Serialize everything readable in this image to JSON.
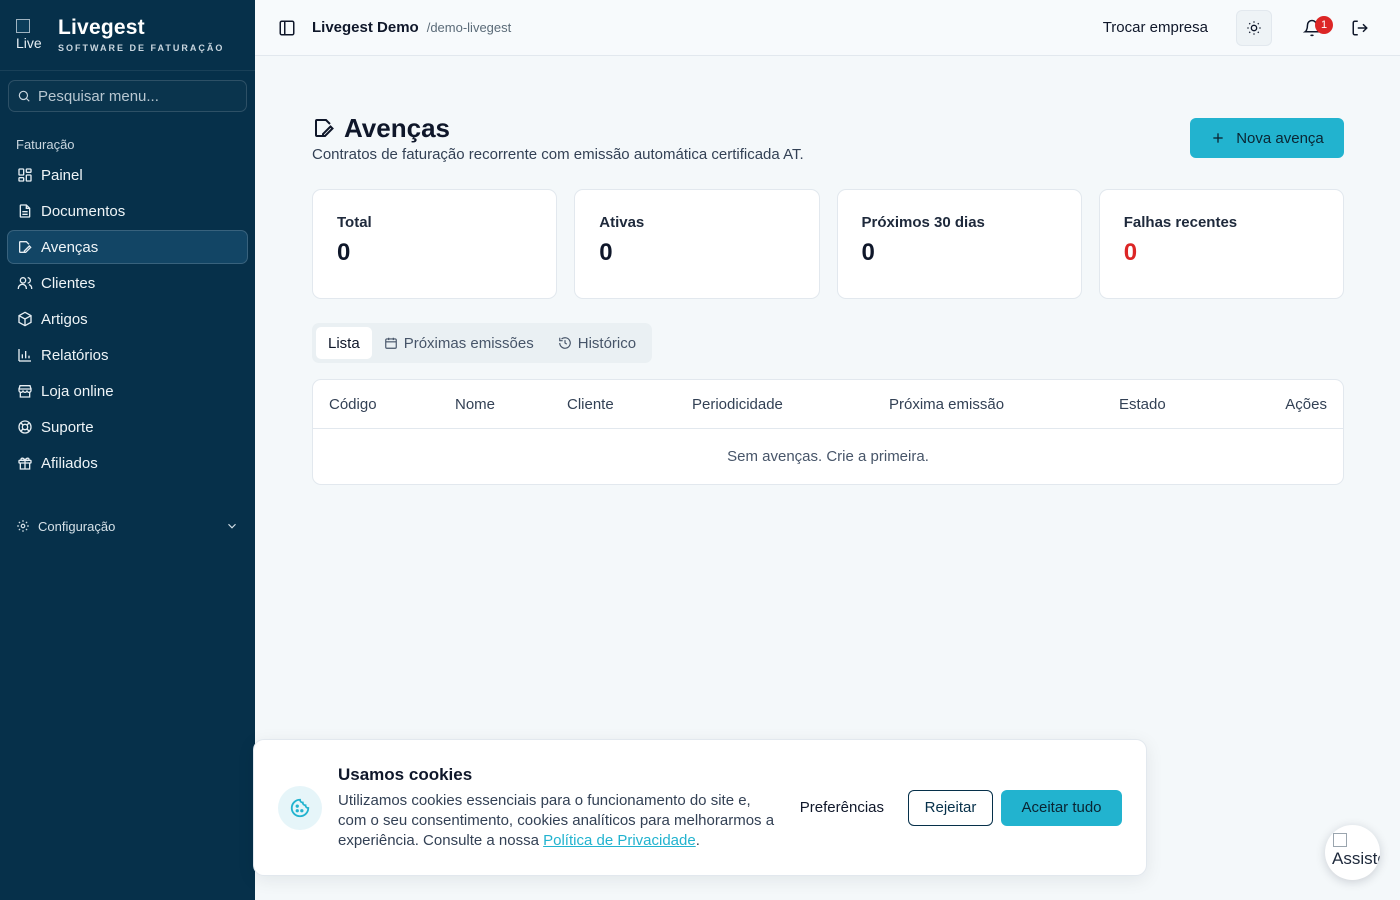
{
  "brand": {
    "logo_alt": "Live",
    "name": "Livegest",
    "subtitle": "SOFTWARE DE FATURAÇÃO"
  },
  "sidebar": {
    "search_placeholder": "Pesquisar menu...",
    "section": "Faturação",
    "items": [
      {
        "label": "Painel",
        "icon": "dashboard-icon"
      },
      {
        "label": "Documentos",
        "icon": "document-icon"
      },
      {
        "label": "Avenças",
        "icon": "edit-icon",
        "active": true
      },
      {
        "label": "Clientes",
        "icon": "users-icon"
      },
      {
        "label": "Artigos",
        "icon": "package-icon"
      },
      {
        "label": "Relatórios",
        "icon": "bar-chart-icon"
      },
      {
        "label": "Loja online",
        "icon": "store-icon"
      },
      {
        "label": "Suporte",
        "icon": "lifebuoy-icon"
      },
      {
        "label": "Afiliados",
        "icon": "gift-icon"
      }
    ],
    "config_label": "Configuração"
  },
  "topbar": {
    "company": "Livegest Demo",
    "slug": "/demo-livegest",
    "switch_company": "Trocar empresa",
    "notifications_count": "1"
  },
  "page": {
    "title": "Avenças",
    "subtitle": "Contratos de faturação recorrente com emissão automática certificada AT.",
    "new_button": "Nova avença"
  },
  "stats": [
    {
      "label": "Total",
      "value": "0"
    },
    {
      "label": "Ativas",
      "value": "0"
    },
    {
      "label": "Próximos 30 dias",
      "value": "0"
    },
    {
      "label": "Falhas recentes",
      "value": "0"
    }
  ],
  "tabs": [
    {
      "label": "Lista"
    },
    {
      "label": "Próximas emissões"
    },
    {
      "label": "Histórico"
    }
  ],
  "table": {
    "columns": [
      "Código",
      "Nome",
      "Cliente",
      "Periodicidade",
      "Próxima emissão",
      "Estado",
      "Ações"
    ],
    "empty": "Sem avenças. Crie a primeira."
  },
  "cookie": {
    "title": "Usamos cookies",
    "body": "Utilizamos cookies essenciais para o funcionamento do site e, com o seu consentimento, cookies analíticos para melhorarmos a experiência. Consulte a nossa ",
    "link": "Política de Privacidade",
    "after_link": ".",
    "preferences": "Preferências",
    "reject": "Rejeitar",
    "accept": "Aceitar tudo"
  },
  "assistant": {
    "alt": "Assistente"
  },
  "colors": {
    "sidebar": "#06304a",
    "accent": "#22b3cf",
    "danger": "#dc2626"
  }
}
